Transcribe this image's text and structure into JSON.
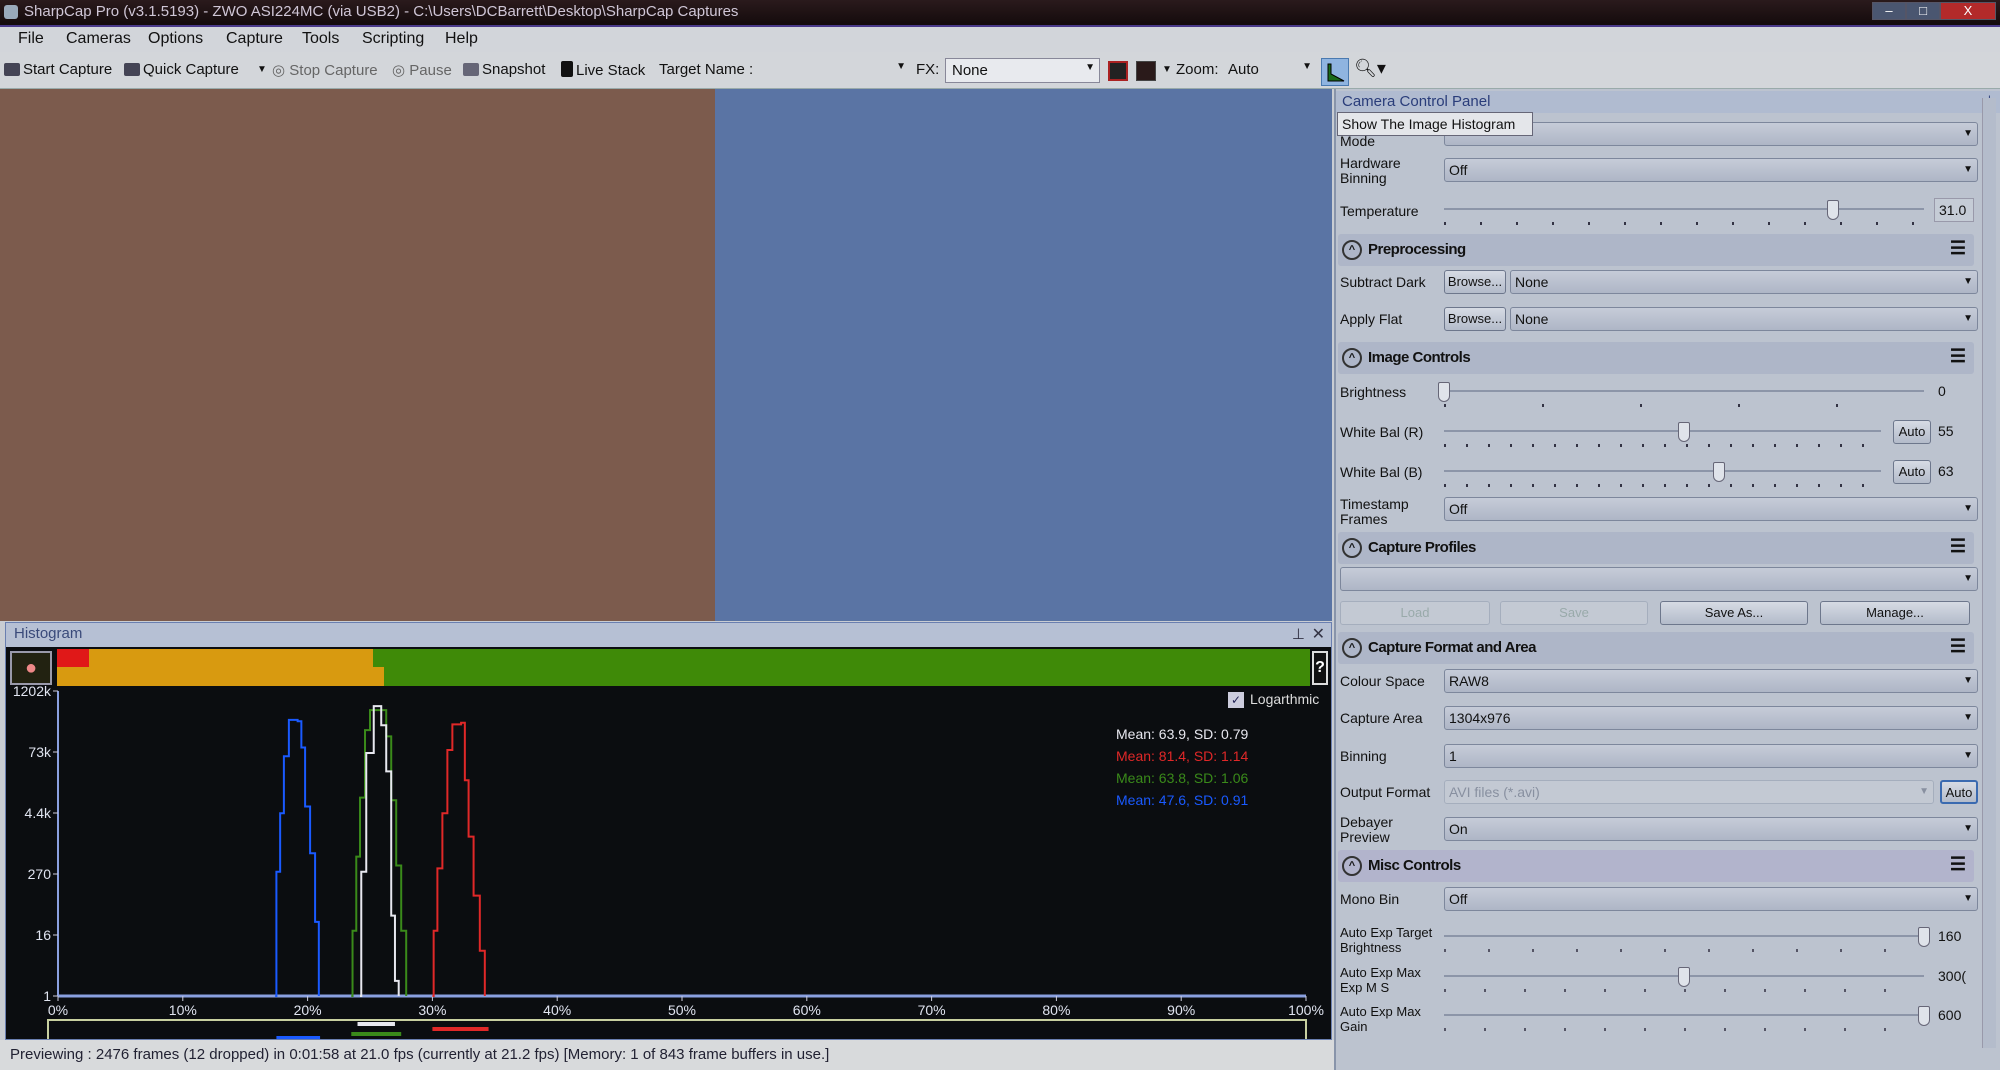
{
  "window": {
    "title": "SharpCap Pro (v3.1.5193) - ZWO ASI224MC (via USB2) - C:\\Users\\DCBarrett\\Desktop\\SharpCap Captures",
    "minimize": "–",
    "maximize": "□",
    "close": "X"
  },
  "menu": [
    "File",
    "Cameras",
    "Options",
    "Capture",
    "Tools",
    "Scripting",
    "Help"
  ],
  "toolbar": {
    "start_capture": "Start Capture",
    "quick_capture": "Quick Capture",
    "stop_capture": "Stop Capture",
    "pause": "Pause",
    "snapshot": "Snapshot",
    "live_stack": "Live Stack",
    "target_name_label": "Target Name :",
    "target_name_value": "",
    "fx_label": "FX:",
    "fx_value": "None",
    "zoom_label": "Zoom:",
    "zoom_value": "Auto"
  },
  "preview": {
    "left_color": "#7c5b4d",
    "right_color": "#5a74a4"
  },
  "histogram": {
    "title": "Histogram",
    "help": "?",
    "logarithmic_label": "Logarthmic",
    "logarithmic": true,
    "stats": [
      {
        "text": "Mean: 63.9, SD: 0.79",
        "color": "#e8e8f0"
      },
      {
        "text": "Mean: 81.4, SD: 1.14",
        "color": "#e02828"
      },
      {
        "text": "Mean: 63.8, SD: 1.06",
        "color": "#3a8a1a"
      },
      {
        "text": "Mean: 47.6, SD: 0.91",
        "color": "#1a5aff"
      }
    ],
    "y_ticks": [
      "1202k",
      "73k",
      "4.4k",
      "270",
      "16",
      "1"
    ],
    "x_ticks": [
      "0%",
      "10%",
      "20%",
      "30%",
      "40%",
      "50%",
      "60%",
      "70%",
      "80%",
      "90%",
      "100%"
    ]
  },
  "chart_data": {
    "type": "line",
    "xlabel": "",
    "ylabel": "",
    "xlim": [
      0,
      100
    ],
    "ylim": [
      1,
      1202000
    ],
    "y_scale": "log",
    "x_tick_labels": [
      "0%",
      "10%",
      "20%",
      "30%",
      "40%",
      "50%",
      "60%",
      "70%",
      "80%",
      "90%",
      "100%"
    ],
    "y_tick_labels": [
      "1202k",
      "73k",
      "4.4k",
      "270",
      "16",
      "1"
    ],
    "series": [
      {
        "color": "#1a5aff",
        "points": [
          [
            17.4,
            1
          ],
          [
            17.5,
            300
          ],
          [
            17.8,
            4400
          ],
          [
            18.1,
            60000
          ],
          [
            18.5,
            320000
          ],
          [
            19.2,
            300000
          ],
          [
            19.5,
            90000
          ],
          [
            19.8,
            6000
          ],
          [
            20.2,
            700
          ],
          [
            20.6,
            30
          ],
          [
            20.9,
            1
          ]
        ]
      },
      {
        "color": "#3a8a1a",
        "points": [
          [
            23.5,
            1
          ],
          [
            23.6,
            20
          ],
          [
            23.9,
            600
          ],
          [
            24.2,
            9000
          ],
          [
            24.6,
            200000
          ],
          [
            25.0,
            500000
          ],
          [
            26.3,
            150000
          ],
          [
            26.7,
            8000
          ],
          [
            27.1,
            400
          ],
          [
            27.5,
            20
          ],
          [
            27.9,
            1
          ]
        ]
      },
      {
        "color": "#e8e8f0",
        "points": [
          [
            24.2,
            1
          ],
          [
            24.3,
            300
          ],
          [
            24.7,
            70000
          ],
          [
            25.3,
            600000
          ],
          [
            25.9,
            250000
          ],
          [
            26.3,
            30000
          ],
          [
            26.7,
            40
          ],
          [
            27.0,
            2
          ],
          [
            27.3,
            1
          ]
        ]
      },
      {
        "color": "#e02828",
        "points": [
          [
            30.0,
            1
          ],
          [
            30.1,
            20
          ],
          [
            30.4,
            350
          ],
          [
            30.8,
            4400
          ],
          [
            31.2,
            80000
          ],
          [
            31.6,
            260000
          ],
          [
            32.3,
            280000
          ],
          [
            32.6,
            20000
          ],
          [
            32.9,
            1500
          ],
          [
            33.3,
            100
          ],
          [
            33.8,
            8
          ],
          [
            34.2,
            1
          ]
        ]
      }
    ],
    "range_markers": [
      {
        "color": "#1a5aff",
        "from": 17.5,
        "to": 21
      },
      {
        "color": "#e8e8f0",
        "from": 24,
        "to": 27
      },
      {
        "color": "#3a8a1a",
        "from": 23.5,
        "to": 27.5
      },
      {
        "color": "#e02828",
        "from": 30,
        "to": 34.5
      }
    ]
  },
  "status": "Previewing : 2476 frames (12 dropped) in 0:01:58 at 21.0 fps  (currently at 21.2 fps) [Memory: 1 of 843 frame buffers in use.]",
  "panel": {
    "title": "Camera Control Panel",
    "tooltip": "Show The Image Histogram",
    "mode": {
      "label": "Mode",
      "value": ""
    },
    "hardware_binning": {
      "label": "Hardware Binning",
      "value": "Off"
    },
    "temperature": {
      "label": "Temperature",
      "value": "31.0",
      "level": 0.81
    },
    "preprocessing": {
      "title": "Preprocessing",
      "subtract_dark": {
        "label": "Subtract Dark",
        "browse": "Browse...",
        "value": "None"
      },
      "apply_flat": {
        "label": "Apply Flat",
        "browse": "Browse...",
        "value": "None"
      }
    },
    "image_controls": {
      "title": "Image Controls",
      "brightness": {
        "label": "Brightness",
        "value": "0",
        "level": 0
      },
      "wb_r": {
        "label": "White Bal (R)",
        "auto": "Auto",
        "value": "55",
        "level": 0.55
      },
      "wb_b": {
        "label": "White Bal (B)",
        "auto": "Auto",
        "value": "63",
        "level": 0.63
      },
      "timestamp": {
        "label": "Timestamp Frames",
        "value": "Off"
      }
    },
    "capture_profiles": {
      "title": "Capture Profiles",
      "value": "",
      "load": "Load",
      "save": "Save",
      "save_as": "Save As...",
      "manage": "Manage..."
    },
    "capture_format": {
      "title": "Capture Format and Area",
      "colour_space": {
        "label": "Colour Space",
        "value": "RAW8"
      },
      "capture_area": {
        "label": "Capture Area",
        "value": "1304x976"
      },
      "binning": {
        "label": "Binning",
        "value": "1"
      },
      "output_format": {
        "label": "Output Format",
        "value": "AVI files (*.avi)",
        "auto": "Auto"
      },
      "debayer": {
        "label": "Debayer Preview",
        "value": "On"
      }
    },
    "misc": {
      "title": "Misc Controls",
      "mono_bin": {
        "label": "Mono Bin",
        "value": "Off"
      },
      "ae_target": {
        "label": "Auto Exp Target Brightness",
        "value": "160",
        "level": 1.0
      },
      "ae_max_exp": {
        "label": "Auto Exp Max Exp M S",
        "value": "300(",
        "level": 0.5
      },
      "ae_max_gain": {
        "label": "Auto Exp Max Gain",
        "value": "600",
        "level": 1.0
      }
    }
  }
}
